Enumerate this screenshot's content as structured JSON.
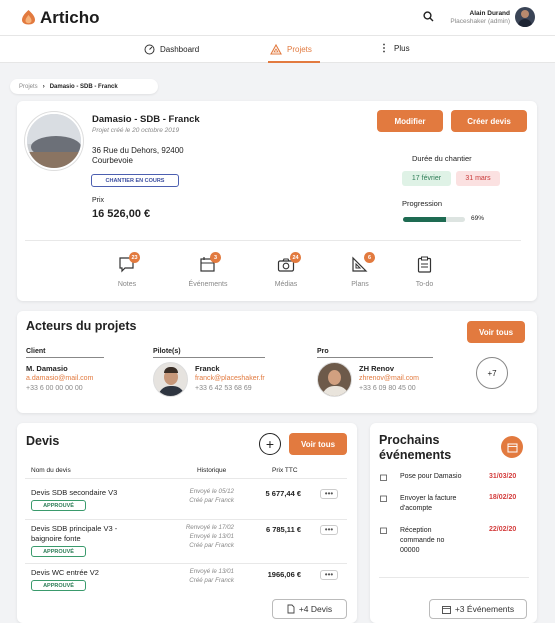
{
  "app": {
    "name": "Articho",
    "user_name": "Alain Durand",
    "user_company": "Placeshaker (admin)"
  },
  "nav": {
    "items": [
      {
        "label": "Dashboard"
      },
      {
        "label": "Projets"
      },
      {
        "label": "Plus"
      }
    ]
  },
  "breadcrumb": {
    "root": "Projets",
    "current": "Damasio - SDB - Franck"
  },
  "project": {
    "title": "Damasio - SDB - Franck",
    "created": "Projet créé le 20 octobre 2019",
    "address_line1": "36 Rue du Dehors, 92400",
    "address_line2": "Courbevoie",
    "status": "CHANTIER EN COURS",
    "price_label": "Prix",
    "price": "16 526,00 €",
    "modify_label": "Modifier",
    "create_quote_label": "Créer devis",
    "duration_label": "Durée du chantier",
    "date_start": "17 février",
    "date_end": "31 mars",
    "progress_label": "Progression",
    "progress_value": 0.69,
    "progress_text": "69%"
  },
  "tools": [
    {
      "label": "Notes",
      "count": "23"
    },
    {
      "label": "Événements",
      "count": "3"
    },
    {
      "label": "Médias",
      "count": "24"
    },
    {
      "label": "Plans",
      "count": "6"
    },
    {
      "label": "To-do",
      "count": ""
    }
  ],
  "actors": {
    "title": "Acteurs du projets",
    "see_all": "Voir tous",
    "client_role": "Client",
    "client_name": "M. Damasio",
    "client_email": "a.damasio@mail.com",
    "client_phone": "+33 6 00 00 00 00",
    "pilot_role": "Pilote(s)",
    "pilot_name": "Franck",
    "pilot_email": "franck@placeshaker.fr",
    "pilot_phone": "+33 6 42 53 68 69",
    "pro_role": "Pro",
    "pro_name": "ZH Renov",
    "pro_email": "zhrenov@mail.com",
    "pro_phone": "+33 6 09 80 45 00",
    "more": "+7"
  },
  "quotes": {
    "title": "Devis",
    "see_all": "Voir tous",
    "col_name": "Nom du devis",
    "col_history": "Historique",
    "col_price": "Prix TTC",
    "more_label": "+4 Devis",
    "rows": [
      {
        "name": "Devis SDB secondaire V3",
        "badge": "APPROUVÉ",
        "hist1": "Envoyé le 05/12",
        "hist2": "Créé par Franck",
        "hist3": "",
        "price": "5 677,44 €"
      },
      {
        "name": "Devis SDB principale V3 - baignoire fonte",
        "badge": "APPROUVÉ",
        "hist1": "Renvoyé le 17/02",
        "hist2": "Envoyé le 13/01",
        "hist3": "Créé par Franck",
        "price": "6 785,11 €"
      },
      {
        "name": "Devis WC entrée V2",
        "badge": "APPROUVÉ",
        "hist1": "Envoyé le 13/01",
        "hist2": "Créé par Franck",
        "hist3": "",
        "price": "1966,06 €"
      }
    ]
  },
  "events": {
    "title_line1": "Prochains",
    "title_line2": "événements",
    "more_label": "+3 Événements",
    "items": [
      {
        "label": "Pose pour Damasio",
        "date": "31/03/20"
      },
      {
        "label": "Envoyer la facture d'acompte",
        "date": "18/02/20"
      },
      {
        "label": "Réception commande no 00000",
        "date": "22/02/20"
      }
    ]
  },
  "colors": {
    "accent": "#e27a3f",
    "green": "#2e7d57",
    "red": "#d43d3d"
  }
}
